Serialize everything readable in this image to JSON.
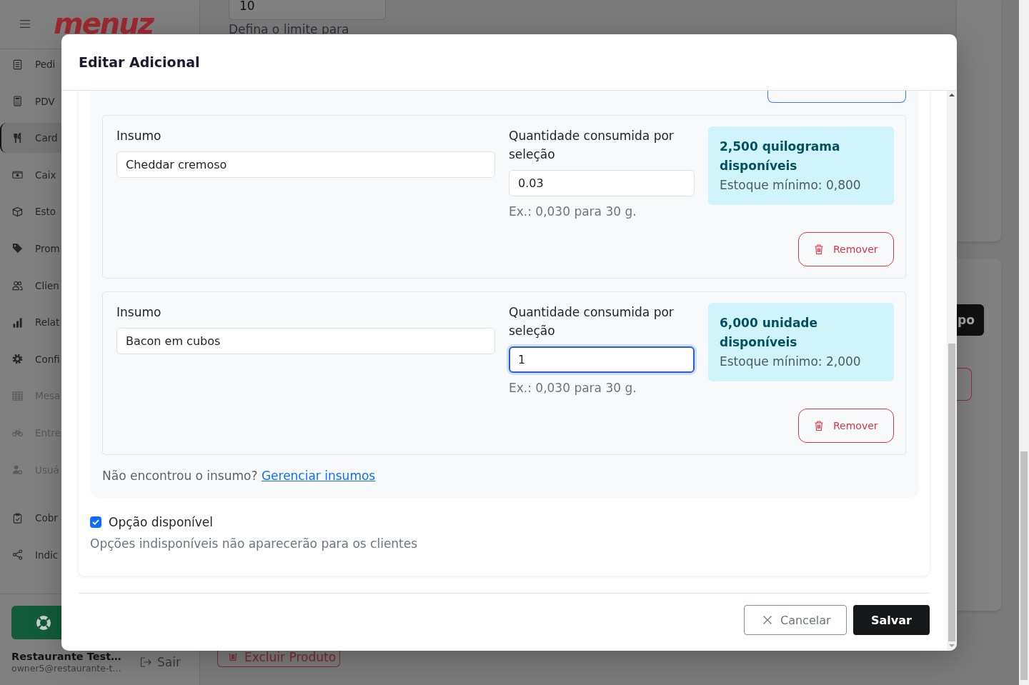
{
  "sidebar": {
    "logo": "menuz",
    "nav": [
      {
        "label": "Pedi",
        "selected": false,
        "disabled": false
      },
      {
        "label": "PDV",
        "selected": false,
        "disabled": false
      },
      {
        "label": "Card",
        "selected": true,
        "disabled": false
      },
      {
        "label": "Caix",
        "selected": false,
        "disabled": false
      },
      {
        "label": "Esto",
        "selected": false,
        "disabled": false
      },
      {
        "label": "Prom",
        "selected": false,
        "disabled": false
      },
      {
        "label": "Clien",
        "selected": false,
        "disabled": false
      },
      {
        "label": "Relat",
        "selected": false,
        "disabled": false
      },
      {
        "label": "Confi",
        "selected": false,
        "disabled": false
      },
      {
        "label": "Mesa",
        "selected": false,
        "disabled": true
      },
      {
        "label": "Entre",
        "selected": false,
        "disabled": true
      },
      {
        "label": "Usuá",
        "selected": false,
        "disabled": true
      }
    ],
    "extra_nav": [
      {
        "label": "Cobr",
        "selected": false,
        "disabled": false
      },
      {
        "label": "Indic",
        "selected": false,
        "disabled": false
      }
    ],
    "account": {
      "name": "Restaurante Test…",
      "email": "owner5@restaurante-t…",
      "logout": "Sair"
    }
  },
  "page": {
    "limit_field": {
      "value": "10"
    },
    "limit_hint": "Defina o limite para",
    "dark_button": "po",
    "delete_button": "Excluir Produto"
  },
  "modal": {
    "title": "Editar Adicional",
    "ingredients": [
      {
        "label": "Insumo",
        "value": "Cheddar cremoso",
        "quantity_label": "Quantidade consumida por seleção",
        "quantity": "0.03",
        "focused": false,
        "hint": "Ex.: 0,030 para 30 g.",
        "stock": "2,500 quilograma disponíveis",
        "minimum": "Estoque mínimo: 0,800",
        "remove": "Remover"
      },
      {
        "label": "Insumo",
        "value": "Bacon em cubos",
        "quantity_label": "Quantidade consumida por seleção",
        "quantity": "1",
        "focused": true,
        "hint": "Ex.: 0,030 para 30 g.",
        "stock": "6,000 unidade disponíveis",
        "minimum": "Estoque mínimo: 2,000",
        "remove": "Remover"
      }
    ],
    "not_found": {
      "text": "Não encontrou o insumo?",
      "link": "Gerenciar insumos"
    },
    "available": {
      "label": "Opção disponível",
      "checked": true,
      "hint": "Opções indisponíveis não aparecerão para os clientes"
    },
    "cancel": "Cancelar",
    "save": "Salvar"
  }
}
